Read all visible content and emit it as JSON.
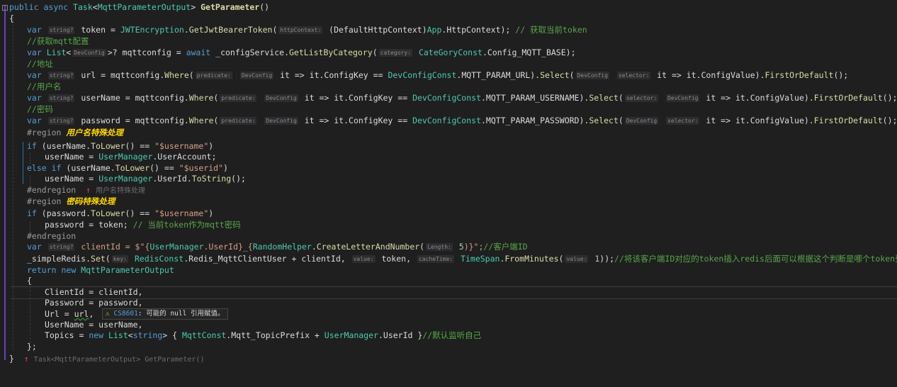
{
  "editor": {
    "lines": {
      "l01": {
        "kw1": "public",
        "kw2": "async",
        "ty": "Task",
        "lt": "<",
        "ty2": "MqttParameterOutput",
        "gt": ">",
        "mt": "GetParameter",
        "paren": "()"
      },
      "l02": {
        "brace": "{"
      },
      "l03": {
        "kw": "var",
        "hint": "string?",
        "name": "token",
        "eq": "=",
        "ty": "JWTEncryption",
        "dot": ".",
        "mt": "GetJwtBearerToken",
        "p1": "(",
        "hint2": "httpContext:",
        "cast": "(DefaultHttpContext)",
        "ty2": "App",
        "rest": ".HttpContext);",
        "cm": "// 获取当前token"
      },
      "l04": {
        "cm": "//获取mqtt配置"
      },
      "l05": {
        "kw": "var",
        "ty": "List",
        "lt": "<",
        "hint": "DevConfig",
        "gtq": ">?",
        "name": "mqttconfig",
        "eq": "=",
        "kw2": "await",
        "obj": "_configService.",
        "mt": "GetListByCategory",
        "p1": "(",
        "hint2": "category:",
        "ty2": "CateGoryConst",
        "rest": ".Config_MQTT_BASE);"
      },
      "l06": {
        "cm": "//地址"
      },
      "l07": {
        "kw": "var",
        "hint": "string?",
        "name": "url",
        "eq": "=",
        "obj": "mqttconfig.",
        "mt": "Where",
        "p1": "(",
        "hint2": "predicate:",
        "hint3": "DevConfig",
        "lam": "it => it.ConfigKey ==",
        "ty": "DevConfigConst",
        "rest": ".MQTT_PARAM_URL).",
        "mt2": "Select",
        "p2": "(",
        "hint4": "DevConfig",
        "hint5": "selector:",
        "lam2": "it => it.ConfigValue).",
        "mt3": "FirstOrDefault",
        "end": "();"
      },
      "l08": {
        "cm": "//用户名"
      },
      "l09": {
        "kw": "var",
        "hint": "string?",
        "name": "userName",
        "eq": "=",
        "obj": "mqttconfig.",
        "mt": "Where",
        "p1": "(",
        "hint2": "predicate:",
        "hint3": "DevConfig",
        "lam": "it => it.ConfigKey ==",
        "ty": "DevConfigConst",
        "rest": ".MQTT_PARAM_USERNAME).",
        "mt2": "Select",
        "p2": "(",
        "hint4": "selector:",
        "hint5": "DevConfig",
        "lam2": "it => it.ConfigValue).",
        "mt3": "FirstOrDefault",
        "end": "();"
      },
      "l10": {
        "cm": "//密码"
      },
      "l11": {
        "kw": "var",
        "hint": "string?",
        "name": "password",
        "eq": "=",
        "obj": "mqttconfig.",
        "mt": "Where",
        "p1": "(",
        "hint2": "predicate:",
        "hint3": "DevConfig",
        "lam": "it => it.ConfigKey ==",
        "ty": "DevConfigConst",
        "rest": ".MQTT_PARAM_PASSWORD).",
        "mt2": "Select",
        "p2": "(",
        "hint4": "DevConfig",
        "hint5": "selector:",
        "lam2": "it => it.ConfigValue).",
        "mt3": "FirstOrDefault",
        "end": "();"
      },
      "l12": {
        "rg": "#region",
        "label": "用户名特殊处理"
      },
      "l13": {
        "kw": "if",
        "a": "(userName.",
        "mt": "ToLower",
        "b": "() ==",
        "st": "\"$username\"",
        "c": ")"
      },
      "l14": {
        "a": "userName =",
        "ty": "UserManager",
        "b": ".UserAccount;"
      },
      "l15": {
        "kw": "else if",
        "a": "(userName.",
        "mt": "ToLower",
        "b": "() ==",
        "st": "\"$userid\"",
        "c": ")"
      },
      "l16": {
        "a": "userName =",
        "ty": "UserManager",
        "b": ".UserId.",
        "mt": "ToString",
        "c": "();"
      },
      "l17": {
        "rg": "#endregion",
        "arrow": "↑",
        "hint": "用户名特殊处理"
      },
      "l18": {
        "rg": "#region",
        "label": "密码特殊处理"
      },
      "l19": {
        "kw": "if",
        "a": "(password.",
        "mt": "ToLower",
        "b": "() ==",
        "st": "\"$username\"",
        "c": ")"
      },
      "l20": {
        "a": "password = token;",
        "cm": "// 当前token作为mqtt密码"
      },
      "l21": {
        "rg": "#endregion"
      },
      "l22": {
        "kw": "var",
        "hint": "string?",
        "a": "clientId = $\"{",
        "ty": "UserManager",
        "b": ".UserId}_{",
        "ty2": "RandomHelper",
        "c": ".",
        "mt": "CreateLetterAndNumber",
        "d": "(",
        "hint2": "Length:",
        "num": "5",
        "e": ")}\";",
        "cm": "//客户端ID"
      },
      "l23": {
        "a": "_simpleRedis.",
        "mt": "Set",
        "p1": "(",
        "hint": "key:",
        "ty": "RedisConst",
        "b": ".Redis_MqttClientUser + clientId,",
        "hint2": "value:",
        "c": "token,",
        "hint3": "cacheTime:",
        "ty2": "TimeSpan",
        "d": ".",
        "mt2": "FromMinutes",
        "e": "(",
        "hint4": "value:",
        "num": "1",
        "f": "));",
        "cm": "//将该客户端ID对应的token插入redis后面可以根据这个判断是哪个token登录的"
      },
      "l24": {
        "kw": "return",
        "kw2": "new",
        "ty": "MqttParameterOutput"
      },
      "l25": {
        "brace": "{"
      },
      "l26": {
        "a": "ClientId = clientId,"
      },
      "l27": {
        "a": "Password = password,"
      },
      "l28": {
        "a": "Url =",
        "b": "url",
        "c": ","
      },
      "l29": {
        "a": "UserName = userName,"
      },
      "l30": {
        "a": "Topics =",
        "kw": "new",
        "ty": "List",
        "lt": "<",
        "kw2": "string",
        "gt": ">",
        "b": "{",
        "ty2": "MqttConst",
        "c": ".Mqtt_TopicPrefix +",
        "ty3": "UserManager",
        "d": ".UserId }",
        "cm": "//默认监听自己"
      },
      "l31": {
        "a": "};"
      },
      "l32": {
        "brace": "}",
        "arrow": "↑",
        "hint": "Task<MqttParameterOutput> GetParameter()"
      }
    },
    "warning": {
      "code": "CS8601",
      "text": ": 可能的 null 引用赋值。"
    }
  },
  "colors": {
    "background": "#1f1f1f",
    "keyword": "#569cd6",
    "type": "#4ec9b0",
    "method": "#dcdcaa",
    "string": "#d69d85",
    "comment": "#57a64a",
    "region_label": "#ffd700"
  }
}
